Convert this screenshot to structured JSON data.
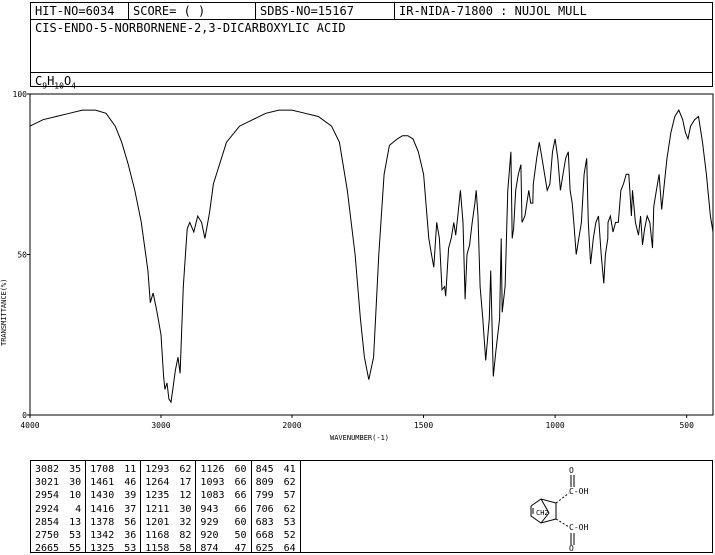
{
  "header": {
    "hit_no": "HIT-NO=6034",
    "score": "SCORE=  (   )",
    "sdbs_no": "SDBS-NO=15167",
    "ir_nida": "IR-NIDA-71800 : NUJOL MULL",
    "compound_name": "CIS-ENDO-5-NORBORNENE-2,3-DICARBOXYLIC ACID",
    "formula_c": "C",
    "formula_c_sub": "9",
    "formula_h": "H",
    "formula_h_sub": "10",
    "formula_o": "O",
    "formula_o_sub": "4"
  },
  "chart_data": {
    "type": "line",
    "title": "",
    "xlabel": "WAVENUMBER(-1)",
    "ylabel": "TRANSMITTANCE(%)",
    "xlim": [
      4000,
      400
    ],
    "ylim": [
      0,
      100
    ],
    "x_ticks": [
      "4000",
      "3000",
      "2000",
      "1500",
      "1000",
      "500"
    ],
    "y_ticks": [
      "100",
      "50",
      "0"
    ],
    "line_color": "#000000",
    "series": [
      {
        "x": [
          4000,
          3900,
          3800,
          3700,
          3600,
          3500,
          3420,
          3350,
          3300,
          3250,
          3200,
          3150,
          3100,
          3082,
          3060,
          3040,
          3021,
          3000,
          2980,
          2970,
          2954,
          2940,
          2924,
          2910,
          2890,
          2870,
          2854,
          2830,
          2800,
          2780,
          2750,
          2720,
          2690,
          2665,
          2630,
          2600,
          2500,
          2400,
          2300,
          2200,
          2100,
          2000,
          1950,
          1900,
          1850,
          1820,
          1790,
          1760,
          1740,
          1725,
          1708,
          1690,
          1670,
          1650,
          1630,
          1600,
          1580,
          1560,
          1540,
          1520,
          1500,
          1480,
          1470,
          1461,
          1450,
          1440,
          1430,
          1420,
          1416,
          1405,
          1395,
          1385,
          1378,
          1370,
          1360,
          1350,
          1342,
          1335,
          1325,
          1315,
          1305,
          1300,
          1293,
          1285,
          1275,
          1264,
          1250,
          1245,
          1235,
          1225,
          1211,
          1205,
          1201,
          1190,
          1180,
          1168,
          1163,
          1158,
          1150,
          1140,
          1130,
          1126,
          1115,
          1100,
          1093,
          1085,
          1083,
          1070,
          1060,
          1050,
          1040,
          1030,
          1020,
          1010,
          1000,
          990,
          980,
          970,
          960,
          950,
          943,
          935,
          929,
          920,
          910,
          900,
          890,
          880,
          874,
          865,
          855,
          845,
          835,
          825,
          815,
          809,
          800,
          799,
          790,
          780,
          770,
          760,
          750,
          740,
          730,
          720,
          710,
          706,
          695,
          683,
          675,
          668,
          660,
          650,
          640,
          630,
          625,
          615,
          605,
          595,
          585,
          575,
          560,
          545,
          530,
          515,
          505,
          495,
          485,
          470,
          455,
          440,
          425,
          410,
          400
        ],
        "y": [
          90,
          92,
          93,
          94,
          95,
          95,
          94,
          90,
          85,
          78,
          70,
          60,
          45,
          35,
          38,
          34,
          30,
          25,
          12,
          8,
          10,
          5,
          4,
          8,
          14,
          18,
          13,
          40,
          58,
          60,
          57,
          62,
          60,
          55,
          63,
          72,
          85,
          90,
          92,
          94,
          95,
          95,
          94,
          93,
          90,
          85,
          70,
          50,
          30,
          18,
          11,
          18,
          50,
          75,
          84,
          86,
          87,
          87,
          86,
          82,
          75,
          55,
          50,
          46,
          60,
          55,
          39,
          40,
          37,
          52,
          55,
          60,
          56,
          62,
          70,
          60,
          36,
          50,
          53,
          60,
          66,
          70,
          62,
          40,
          30,
          17,
          30,
          45,
          12,
          20,
          30,
          55,
          32,
          40,
          70,
          82,
          55,
          58,
          70,
          75,
          78,
          60,
          62,
          70,
          66,
          66,
          72,
          80,
          85,
          80,
          75,
          70,
          72,
          82,
          86,
          80,
          70,
          75,
          80,
          82,
          70,
          66,
          60,
          50,
          55,
          60,
          75,
          80,
          60,
          47,
          55,
          60,
          62,
          50,
          41,
          50,
          55,
          60,
          62,
          57,
          60,
          60,
          70,
          72,
          75,
          75,
          62,
          70,
          60,
          56,
          62,
          53,
          58,
          62,
          60,
          52,
          65,
          70,
          75,
          64,
          72,
          80,
          88,
          93,
          95,
          92,
          88,
          86,
          90,
          92,
          93,
          85,
          75,
          62,
          57
        ]
      }
    ]
  },
  "peak_table": [
    {
      "wn": "3082",
      "t": "35"
    },
    {
      "wn": "3021",
      "t": "30"
    },
    {
      "wn": "2954",
      "t": "10"
    },
    {
      "wn": "2924",
      "t": "4"
    },
    {
      "wn": "2854",
      "t": "13"
    },
    {
      "wn": "2750",
      "t": "53"
    },
    {
      "wn": "2665",
      "t": "55"
    },
    {
      "wn": "1708",
      "t": "11"
    },
    {
      "wn": "1461",
      "t": "46"
    },
    {
      "wn": "1430",
      "t": "39"
    },
    {
      "wn": "1416",
      "t": "37"
    },
    {
      "wn": "1378",
      "t": "56"
    },
    {
      "wn": "1342",
      "t": "36"
    },
    {
      "wn": "1325",
      "t": "53"
    },
    {
      "wn": "1293",
      "t": "62"
    },
    {
      "wn": "1264",
      "t": "17"
    },
    {
      "wn": "1235",
      "t": "12"
    },
    {
      "wn": "1211",
      "t": "30"
    },
    {
      "wn": "1201",
      "t": "32"
    },
    {
      "wn": "1168",
      "t": "82"
    },
    {
      "wn": "1158",
      "t": "58"
    },
    {
      "wn": "1126",
      "t": "60"
    },
    {
      "wn": "1093",
      "t": "66"
    },
    {
      "wn": "1083",
      "t": "66"
    },
    {
      "wn": "943",
      "t": "66"
    },
    {
      "wn": "929",
      "t": "60"
    },
    {
      "wn": "920",
      "t": "50"
    },
    {
      "wn": "874",
      "t": "47"
    },
    {
      "wn": "845",
      "t": "41"
    },
    {
      "wn": "809",
      "t": "62"
    },
    {
      "wn": "799",
      "t": "57"
    },
    {
      "wn": "706",
      "t": "62"
    },
    {
      "wn": "683",
      "t": "53"
    },
    {
      "wn": "668",
      "t": "52"
    },
    {
      "wn": "625",
      "t": "64"
    }
  ],
  "structure": {
    "label_top_o": "O",
    "label_top_oh": "C-OH",
    "label_ch2": "CH2",
    "label_bottom_oh": "C-OH",
    "label_bottom_o": "O"
  }
}
